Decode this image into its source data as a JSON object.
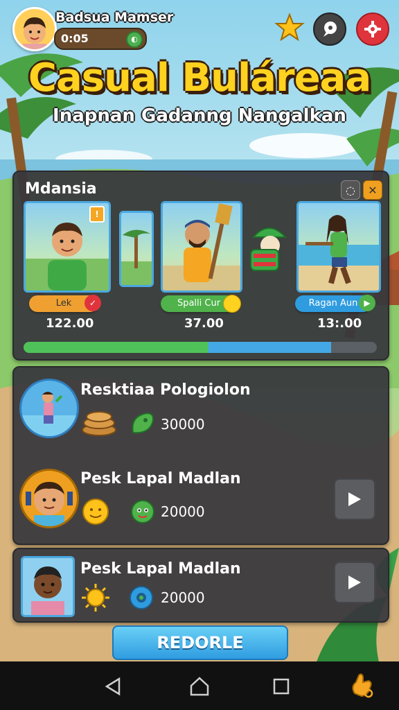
{
  "player": {
    "name": "Badsua Mamser",
    "score": "0:05"
  },
  "game": {
    "title": "Casual Buláreaa",
    "subtitle": "Inapnan Gadanng Nangalkan"
  },
  "top_icons": [
    "star-icon",
    "chat-icon",
    "settings-gear-icon"
  ],
  "colors": {
    "title_yellow": "#ffd21f",
    "panel": "#37373c",
    "accent_blue": "#45a8e6",
    "accent_green": "#4fc35a"
  },
  "panel": {
    "title": "Mdansia",
    "characters": [
      {
        "label": "Lek",
        "value": "122.00"
      },
      {
        "label": "Spalli Cur",
        "value": "37.00"
      },
      {
        "label": "Ragan Aun",
        "value": "13:.00"
      }
    ],
    "progress": 0.87
  },
  "quests": [
    {
      "title": "Resktiaa Pologiolon",
      "reward": "30000"
    },
    {
      "title": "Pesk Lapal Madlan",
      "reward": "20000"
    },
    {
      "title": "Pesk Lapal Madlan",
      "reward": "20000"
    }
  ],
  "main_button": "REDORLE"
}
